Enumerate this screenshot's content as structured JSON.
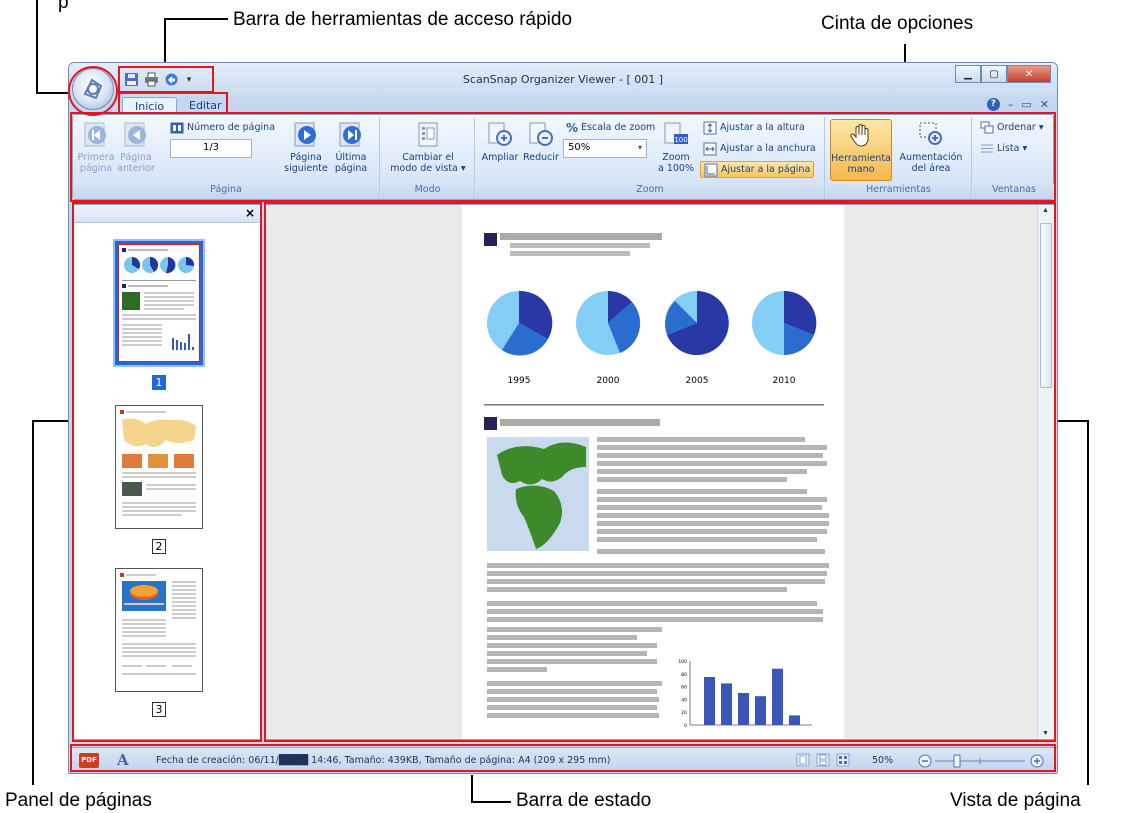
{
  "callouts": {
    "qat": "Barra de herramientas de acceso rápido",
    "ribbon": "Cinta de opciones",
    "pages_panel": "Panel de páginas",
    "status_bar": "Barra de estado",
    "page_view": "Vista de página",
    "top_left": "p"
  },
  "window": {
    "title": "ScanSnap Organizer Viewer - [ 001 ]"
  },
  "tabs": [
    {
      "label": "Inicio",
      "active": true
    },
    {
      "label": "Editar",
      "active": false
    }
  ],
  "ribbon": {
    "pagina": {
      "label": "Página",
      "first": "Primera página",
      "first_l1": "Primera",
      "first_l2": "página",
      "prev_l1": "Página",
      "prev_l2": "anterior",
      "page_number_label": "Número de página",
      "page_number_value": "1/3",
      "next_l1": "Página",
      "next_l2": "siguiente",
      "last_l1": "Última",
      "last_l2": "página"
    },
    "modo": {
      "label": "Modo",
      "change_l1": "Cambiar el",
      "change_l2": "modo de vista"
    },
    "zoom": {
      "label": "Zoom",
      "zoom_in": "Ampliar",
      "zoom_out": "Reducir",
      "scale_label": "Escala de zoom",
      "scale_value": "50%",
      "zoom100_l1": "Zoom",
      "zoom100_l2": "a 100%",
      "fit_height": "Ajustar a la altura",
      "fit_width": "Ajustar a la anchura",
      "fit_page": "Ajustar a la página"
    },
    "herramientas": {
      "label": "Herramientas",
      "hand_l1": "Herramienta",
      "hand_l2": "mano",
      "area_l1": "Aumentación",
      "area_l2": "del área"
    },
    "ventanas": {
      "label": "Ventanas",
      "arrange": "Ordenar",
      "list": "Lista"
    }
  },
  "page_panel": {
    "close": "×",
    "pages": [
      "1",
      "2",
      "3"
    ]
  },
  "document": {
    "chart_years": [
      "1995",
      "2000",
      "2005",
      "2010"
    ],
    "bar_axis_ticks": [
      "100",
      "80",
      "60",
      "40",
      "20",
      "0"
    ],
    "bar_values": [
      75,
      65,
      50,
      45,
      88,
      15
    ]
  },
  "status": {
    "pdf_badge": "PDF",
    "font_glyph": "A",
    "info": "Fecha de creación: 06/11/████ 14:46, Tamaño: 439KB, Tamaño de página: A4 (209 x 295 mm)",
    "zoom": "50%"
  },
  "colors": {
    "annotation_red": "#e8141c",
    "ribbon_blue": "#15428b",
    "selected_orange": "#f6b74c"
  }
}
